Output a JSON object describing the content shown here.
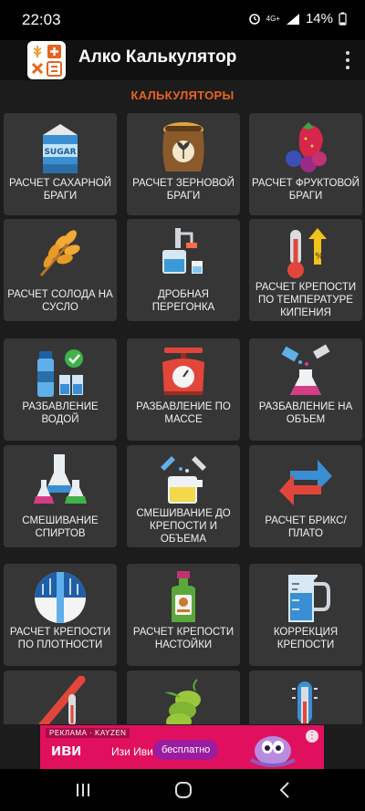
{
  "status": {
    "time": "22:03",
    "network": "4G+",
    "battery": "14%"
  },
  "app": {
    "title": "Алко Калькулятор"
  },
  "section": {
    "title": "КАЛЬКУЛЯТОРЫ"
  },
  "cards": [
    {
      "label": "РАСЧЕТ САХАРНОЙ БРАГИ",
      "icon": "sugar-icon"
    },
    {
      "label": "РАСЧЕТ ЗЕРНОВОЙ БРАГИ",
      "icon": "grain-sack-icon"
    },
    {
      "label": "РАСЧЕТ ФРУКТОВОЙ БРАГИ",
      "icon": "berries-icon"
    },
    {
      "label": "РАСЧЕТ СОЛОДА НА СУСЛО",
      "icon": "wheat-icon"
    },
    {
      "label": "ДРОБНАЯ ПЕРЕГОНКА",
      "icon": "distiller-icon"
    },
    {
      "label": "РАСЧЕТ КРЕПОСТИ ПО ТЕМПЕРАТУРЕ КИПЕНИЯ",
      "icon": "thermometer-percent-icon"
    },
    {
      "label": "РАЗБАВЛЕНИЕ ВОДОЙ",
      "icon": "water-bottle-icon"
    },
    {
      "label": "РАЗБАВЛЕНИЕ ПО МАССЕ",
      "icon": "scale-icon"
    },
    {
      "label": "РАЗБАВЛЕНИЕ НА ОБЪЕМ",
      "icon": "flask-pour-icon"
    },
    {
      "label": "СМЕШИВАНИЕ СПИРТОВ",
      "icon": "flasks-icon"
    },
    {
      "label": "СМЕШИВАНИЕ ДО КРЕПОСТИ И ОБЪЕМА",
      "icon": "beaker-mix-icon"
    },
    {
      "label": "РАСЧЕТ БРИКС/ ПЛАТО",
      "icon": "convert-arrows-icon"
    },
    {
      "label": "РАСЧЕТ КРЕПОСТИ ПО ПЛОТНОСТИ",
      "icon": "hydrometer-icon"
    },
    {
      "label": "РАСЧЕТ КРЕПОСТИ НАСТОЙКИ",
      "icon": "tincture-bottle-icon"
    },
    {
      "label": "КОРРЕКЦИЯ КРЕПОСТИ",
      "icon": "measuring-jug-icon"
    },
    {
      "label": "",
      "icon": "refractometer-icon"
    },
    {
      "label": "",
      "icon": "hops-icon"
    },
    {
      "label": "",
      "icon": "thermometer-icon"
    }
  ],
  "ad": {
    "tag": "РЕКЛАМА · KAYZEN",
    "logo": "иви",
    "name": "Изи Иви",
    "cta": "бесплатно",
    "more": "⋮"
  },
  "colors": {
    "accent": "#e8641e",
    "card": "#363636",
    "background": "#1c1c1c",
    "ad": "#e0105e"
  }
}
